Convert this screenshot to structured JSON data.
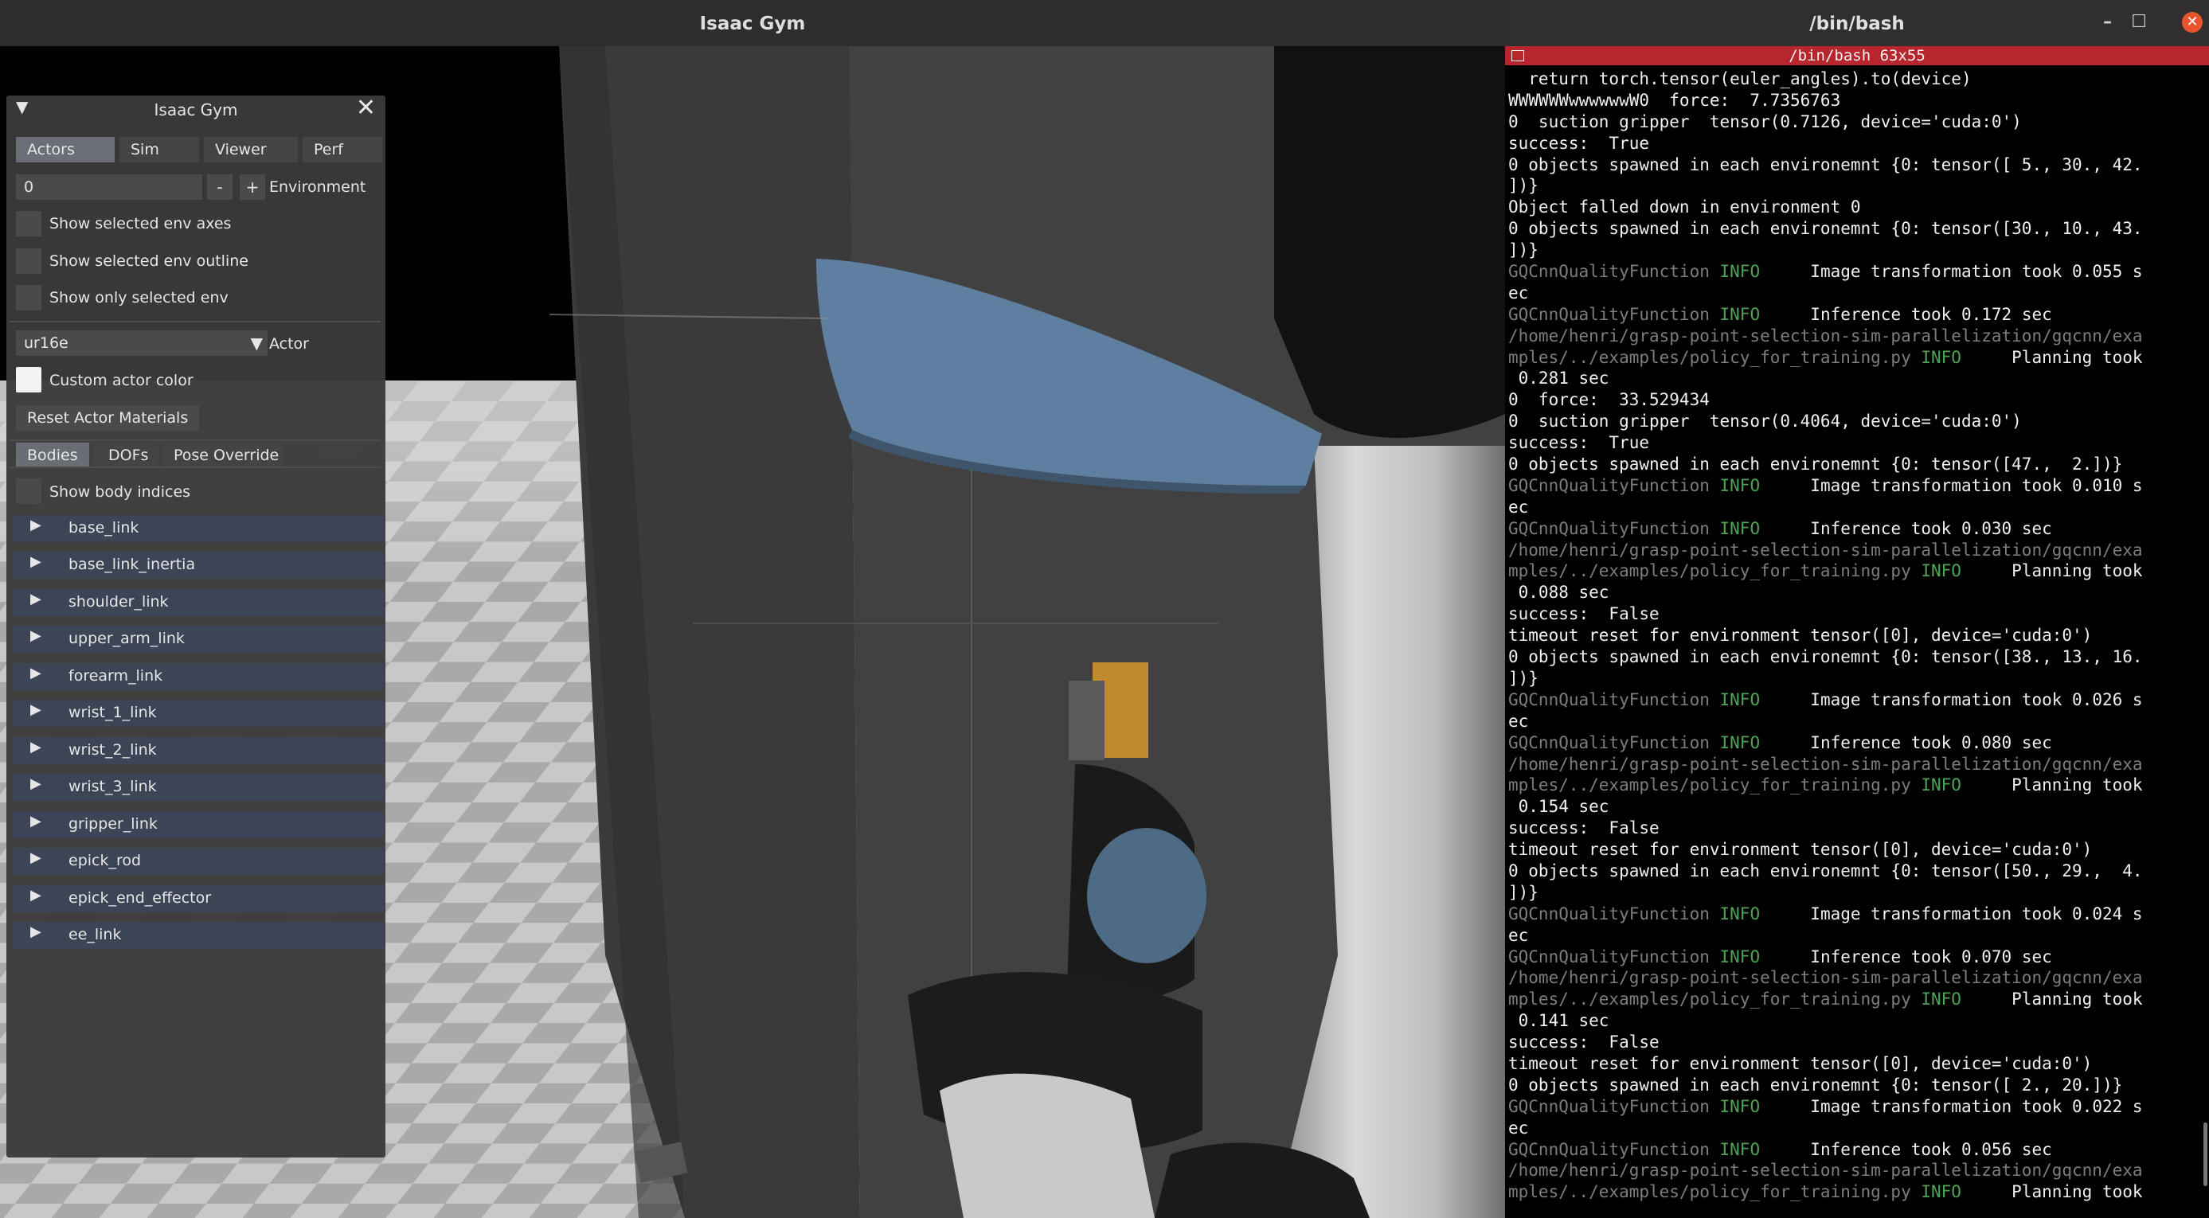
{
  "isaac_window": {
    "title": "Isaac Gym"
  },
  "gui": {
    "title": "Isaac Gym",
    "tabs": [
      {
        "label": "Actors",
        "active": true
      },
      {
        "label": "Sim",
        "active": false
      },
      {
        "label": "Viewer",
        "active": false
      },
      {
        "label": "Perf",
        "active": false
      }
    ],
    "environment": {
      "value": "0",
      "minus": "-",
      "plus": "+",
      "label": "Environment"
    },
    "checkboxes": [
      {
        "label": "Show selected env axes",
        "checked": false
      },
      {
        "label": "Show selected env outline",
        "checked": false
      },
      {
        "label": "Show only selected env",
        "checked": false
      }
    ],
    "actor": {
      "value": "ur16e",
      "label": "Actor"
    },
    "custom_color": {
      "label": "Custom actor color"
    },
    "reset_materials": "Reset Actor Materials",
    "subtabs": [
      {
        "label": "Bodies",
        "active": true
      },
      {
        "label": "DOFs",
        "active": false
      },
      {
        "label": "Pose Override",
        "active": false
      }
    ],
    "show_body_indices": {
      "label": "Show body indices",
      "checked": false
    },
    "bodies": [
      "base_link",
      "base_link_inertia",
      "shoulder_link",
      "upper_arm_link",
      "forearm_link",
      "wrist_1_link",
      "wrist_2_link",
      "wrist_3_link",
      "gripper_link",
      "epick_rod",
      "epick_end_effector",
      "ee_link"
    ],
    "icons": {
      "collapse": "triangle-down-icon",
      "close": "close-icon",
      "row_expand": "triangle-right-icon",
      "dropdown": "dropdown-arrow-icon"
    }
  },
  "terminal": {
    "title": "/bin/bash",
    "tab_title": "/bin/bash 63x55",
    "window_buttons": {
      "minimize": "–",
      "maximize": "☐",
      "close": "✕"
    },
    "colors": {
      "tab_bar": "#b7262c",
      "info": "#4ea354",
      "logger": "#7d7d7d",
      "close_button": "#e9542c"
    },
    "lines": [
      {
        "t": "  return torch.tensor(euler_angles).to(device)"
      },
      {
        "t": "WWWWWWwwwwwwW0  force:  7.7356763"
      },
      {
        "t": "0  suction gripper  tensor(0.7126, device='cuda:0')"
      },
      {
        "t": "success:  True"
      },
      {
        "t": "0 objects spawned in each environemnt {0: tensor([ 5., 30., 42."
      },
      {
        "t": "])}"
      },
      {
        "t": "Object falled down in environment 0"
      },
      {
        "t": "0 objects spawned in each environemnt {0: tensor([30., 10., 43."
      },
      {
        "t": "])}"
      },
      {
        "a": "GQCnnQualityFunction ",
        "b": "INFO",
        "c": "     Image transformation took 0.055 s"
      },
      {
        "t": "ec"
      },
      {
        "a": "GQCnnQualityFunction ",
        "b": "INFO",
        "c": "     Inference took 0.172 sec"
      },
      {
        "a": "/home/henri/grasp-point-selection-sim-parallelization/gqcnn/exa"
      },
      {
        "a": "mples/../examples/policy_for_training.py ",
        "b": "INFO",
        "c": "     Planning took"
      },
      {
        "t": " 0.281 sec"
      },
      {
        "t": "0  force:  33.529434"
      },
      {
        "t": "0  suction gripper  tensor(0.4064, device='cuda:0')"
      },
      {
        "t": "success:  True"
      },
      {
        "t": "0 objects spawned in each environemnt {0: tensor([47.,  2.])}"
      },
      {
        "a": "GQCnnQualityFunction ",
        "b": "INFO",
        "c": "     Image transformation took 0.010 s"
      },
      {
        "t": "ec"
      },
      {
        "a": "GQCnnQualityFunction ",
        "b": "INFO",
        "c": "     Inference took 0.030 sec"
      },
      {
        "a": "/home/henri/grasp-point-selection-sim-parallelization/gqcnn/exa"
      },
      {
        "a": "mples/../examples/policy_for_training.py ",
        "b": "INFO",
        "c": "     Planning took"
      },
      {
        "t": " 0.088 sec"
      },
      {
        "t": "success:  False"
      },
      {
        "t": "timeout reset for environment tensor([0], device='cuda:0')"
      },
      {
        "t": "0 objects spawned in each environemnt {0: tensor([38., 13., 16."
      },
      {
        "t": "])}"
      },
      {
        "a": "GQCnnQualityFunction ",
        "b": "INFO",
        "c": "     Image transformation took 0.026 s"
      },
      {
        "t": "ec"
      },
      {
        "a": "GQCnnQualityFunction ",
        "b": "INFO",
        "c": "     Inference took 0.080 sec"
      },
      {
        "a": "/home/henri/grasp-point-selection-sim-parallelization/gqcnn/exa"
      },
      {
        "a": "mples/../examples/policy_for_training.py ",
        "b": "INFO",
        "c": "     Planning took"
      },
      {
        "t": " 0.154 sec"
      },
      {
        "t": "success:  False"
      },
      {
        "t": "timeout reset for environment tensor([0], device='cuda:0')"
      },
      {
        "t": "0 objects spawned in each environemnt {0: tensor([50., 29.,  4."
      },
      {
        "t": "])}"
      },
      {
        "a": "GQCnnQualityFunction ",
        "b": "INFO",
        "c": "     Image transformation took 0.024 s"
      },
      {
        "t": "ec"
      },
      {
        "a": "GQCnnQualityFunction ",
        "b": "INFO",
        "c": "     Inference took 0.070 sec"
      },
      {
        "a": "/home/henri/grasp-point-selection-sim-parallelization/gqcnn/exa"
      },
      {
        "a": "mples/../examples/policy_for_training.py ",
        "b": "INFO",
        "c": "     Planning took"
      },
      {
        "t": " 0.141 sec"
      },
      {
        "t": "success:  False"
      },
      {
        "t": "timeout reset for environment tensor([0], device='cuda:0')"
      },
      {
        "t": "0 objects spawned in each environemnt {0: tensor([ 2., 20.])}"
      },
      {
        "a": "GQCnnQualityFunction ",
        "b": "INFO",
        "c": "     Image transformation took 0.022 s"
      },
      {
        "t": "ec"
      },
      {
        "a": "GQCnnQualityFunction ",
        "b": "INFO",
        "c": "     Inference took 0.056 sec"
      },
      {
        "a": "/home/henri/grasp-point-selection-sim-parallelization/gqcnn/exa"
      },
      {
        "a": "mples/../examples/policy_for_training.py ",
        "b": "INFO",
        "c": "     Planning took"
      }
    ]
  }
}
